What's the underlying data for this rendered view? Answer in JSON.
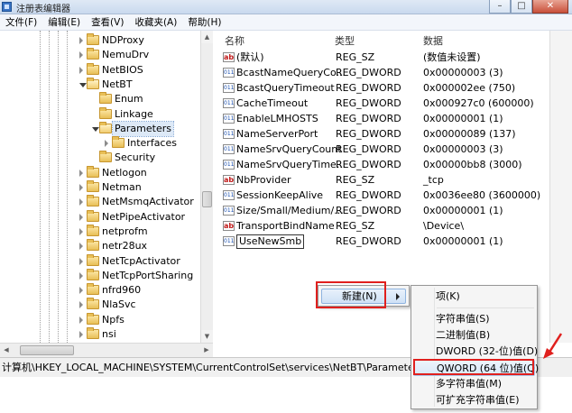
{
  "window": {
    "title": "注册表编辑器",
    "buttons": [
      "–",
      "□",
      "✕"
    ]
  },
  "menu": [
    "文件(F)",
    "编辑(E)",
    "查看(V)",
    "收藏夹(A)",
    "帮助(H)"
  ],
  "tree": [
    {
      "label": "NDProxy",
      "depth": 0,
      "state": "closed"
    },
    {
      "label": "NemuDrv",
      "depth": 0,
      "state": "closed"
    },
    {
      "label": "NetBIOS",
      "depth": 0,
      "state": "closed"
    },
    {
      "label": "NetBT",
      "depth": 0,
      "state": "open"
    },
    {
      "label": "Enum",
      "depth": 1,
      "state": "none"
    },
    {
      "label": "Linkage",
      "depth": 1,
      "state": "none"
    },
    {
      "label": "Parameters",
      "depth": 1,
      "state": "open",
      "selected": true
    },
    {
      "label": "Interfaces",
      "depth": 2,
      "state": "closed"
    },
    {
      "label": "Security",
      "depth": 1,
      "state": "none"
    },
    {
      "label": "Netlogon",
      "depth": 0,
      "state": "closed"
    },
    {
      "label": "Netman",
      "depth": 0,
      "state": "closed"
    },
    {
      "label": "NetMsmqActivator",
      "depth": 0,
      "state": "closed"
    },
    {
      "label": "NetPipeActivator",
      "depth": 0,
      "state": "closed"
    },
    {
      "label": "netprofm",
      "depth": 0,
      "state": "closed"
    },
    {
      "label": "netr28ux",
      "depth": 0,
      "state": "closed"
    },
    {
      "label": "NetTcpActivator",
      "depth": 0,
      "state": "closed"
    },
    {
      "label": "NetTcpPortSharing",
      "depth": 0,
      "state": "closed"
    },
    {
      "label": "nfrd960",
      "depth": 0,
      "state": "closed"
    },
    {
      "label": "NlaSvc",
      "depth": 0,
      "state": "closed"
    },
    {
      "label": "Npfs",
      "depth": 0,
      "state": "closed"
    },
    {
      "label": "nsi",
      "depth": 0,
      "state": "closed"
    }
  ],
  "columns": {
    "name": "名称",
    "type": "类型",
    "data": "数据"
  },
  "values": [
    {
      "name": "(默认)",
      "type": "REG_SZ",
      "data": "(数值未设置)",
      "icon": "sz"
    },
    {
      "name": "BcastNameQueryCo...",
      "type": "REG_DWORD",
      "data": "0x00000003 (3)",
      "icon": "dw"
    },
    {
      "name": "BcastQueryTimeout",
      "type": "REG_DWORD",
      "data": "0x000002ee (750)",
      "icon": "dw"
    },
    {
      "name": "CacheTimeout",
      "type": "REG_DWORD",
      "data": "0x000927c0 (600000)",
      "icon": "dw"
    },
    {
      "name": "EnableLMHOSTS",
      "type": "REG_DWORD",
      "data": "0x00000001 (1)",
      "icon": "dw"
    },
    {
      "name": "NameServerPort",
      "type": "REG_DWORD",
      "data": "0x00000089 (137)",
      "icon": "dw"
    },
    {
      "name": "NameSrvQueryCount",
      "type": "REG_DWORD",
      "data": "0x00000003 (3)",
      "icon": "dw"
    },
    {
      "name": "NameSrvQueryTime...",
      "type": "REG_DWORD",
      "data": "0x00000bb8 (3000)",
      "icon": "dw"
    },
    {
      "name": "NbProvider",
      "type": "REG_SZ",
      "data": "_tcp",
      "icon": "sz"
    },
    {
      "name": "SessionKeepAlive",
      "type": "REG_DWORD",
      "data": "0x0036ee80 (3600000)",
      "icon": "dw"
    },
    {
      "name": "Size/Small/Medium/...",
      "type": "REG_DWORD",
      "data": "0x00000001 (1)",
      "icon": "dw"
    },
    {
      "name": "TransportBindName",
      "type": "REG_SZ",
      "data": "\\Device\\",
      "icon": "sz"
    },
    {
      "name": "UseNewSmb",
      "type": "REG_DWORD",
      "data": "0x00000001 (1)",
      "icon": "dw",
      "editing": true
    }
  ],
  "status_path": "计算机\\HKEY_LOCAL_MACHINE\\SYSTEM\\CurrentControlSet\\services\\NetBT\\Parameters",
  "context_menu": {
    "new_label": "新建(N)"
  },
  "submenu": {
    "items": [
      {
        "label": "项(K)",
        "sep_after": true
      },
      {
        "label": "字符串值(S)"
      },
      {
        "label": "二进制值(B)"
      },
      {
        "label": "DWORD (32-位)值(D)"
      },
      {
        "label": "QWORD (64 位)值(Q)",
        "hover": true
      },
      {
        "label": "多字符串值(M)"
      },
      {
        "label": "可扩充字符串值(E)"
      }
    ]
  },
  "annotation_color": "#e0201e"
}
